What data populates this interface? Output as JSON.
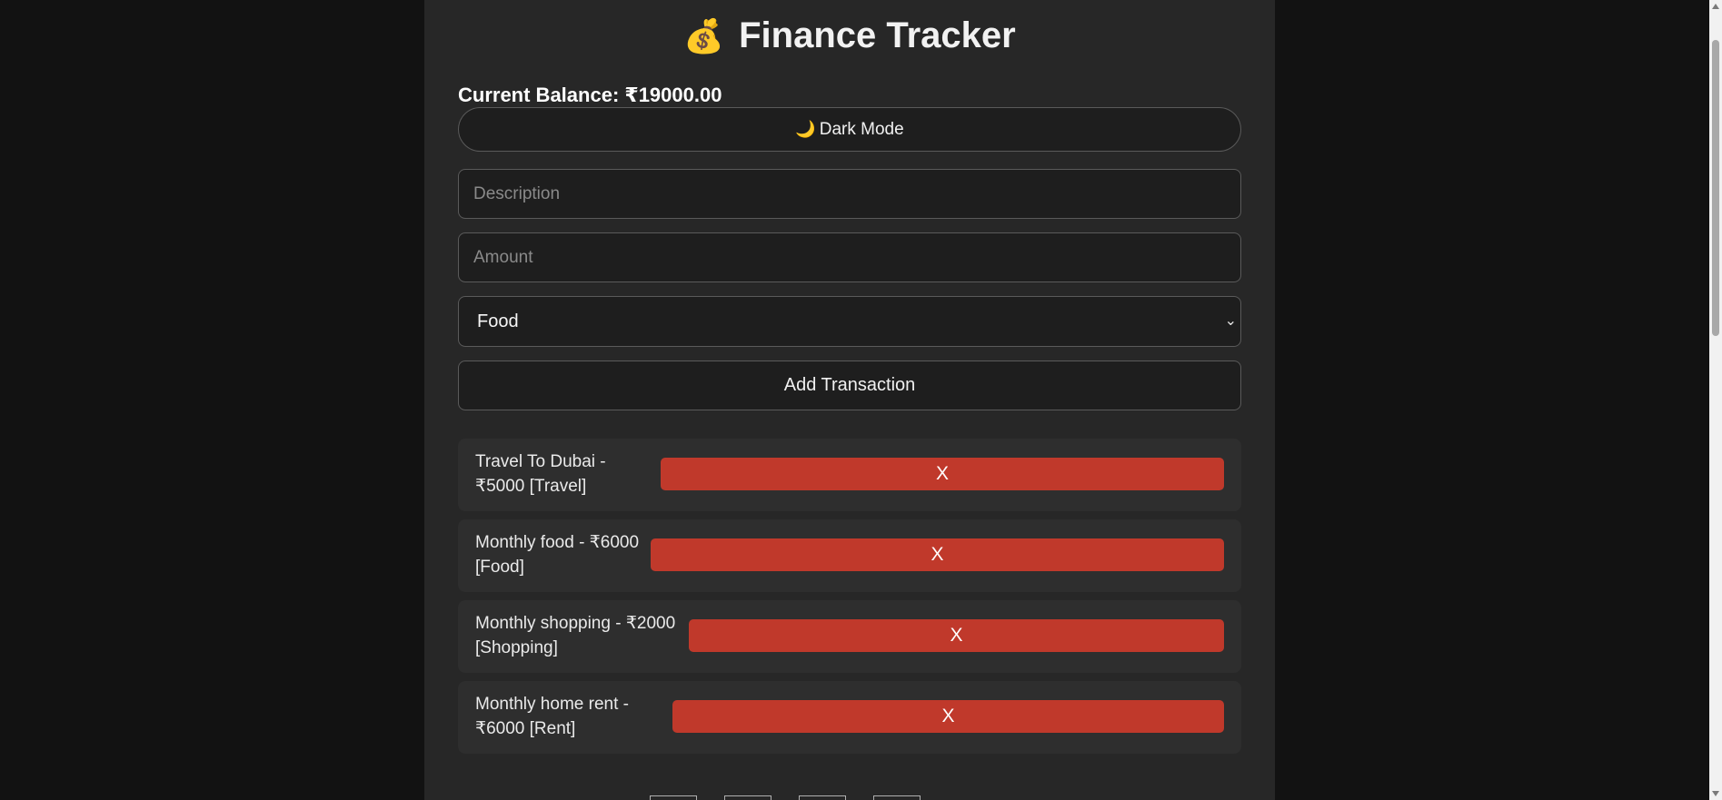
{
  "app": {
    "title_icon": "money-bag",
    "title": "Finance Tracker"
  },
  "balance": {
    "text": "Current Balance: ₹19000.00"
  },
  "theme_toggle": {
    "icon": "moon",
    "label": "Dark Mode"
  },
  "form": {
    "description": {
      "value": "",
      "placeholder": "Description"
    },
    "amount": {
      "value": "",
      "placeholder": "Amount"
    },
    "category": {
      "selected": "Food"
    },
    "submit_label": "Add Transaction"
  },
  "transactions": [
    {
      "line1": "Travel To Dubai -",
      "line2": "₹5000 [Travel]",
      "delete_label": "X"
    },
    {
      "line1": "Monthly food - ₹6000",
      "line2": "[Food]",
      "delete_label": "X"
    },
    {
      "line1": "Monthly shopping - ₹2000",
      "line2": "[Shopping]",
      "delete_label": "X"
    },
    {
      "line1": "Monthly home rent -",
      "line2": "₹6000 [Rent]",
      "delete_label": "X"
    }
  ],
  "colors": {
    "page_bg": "#121212",
    "card_bg": "#272727",
    "row_bg": "#2e2e2e",
    "input_bg": "#1e1e1e",
    "delete_red": "#c0392b"
  }
}
